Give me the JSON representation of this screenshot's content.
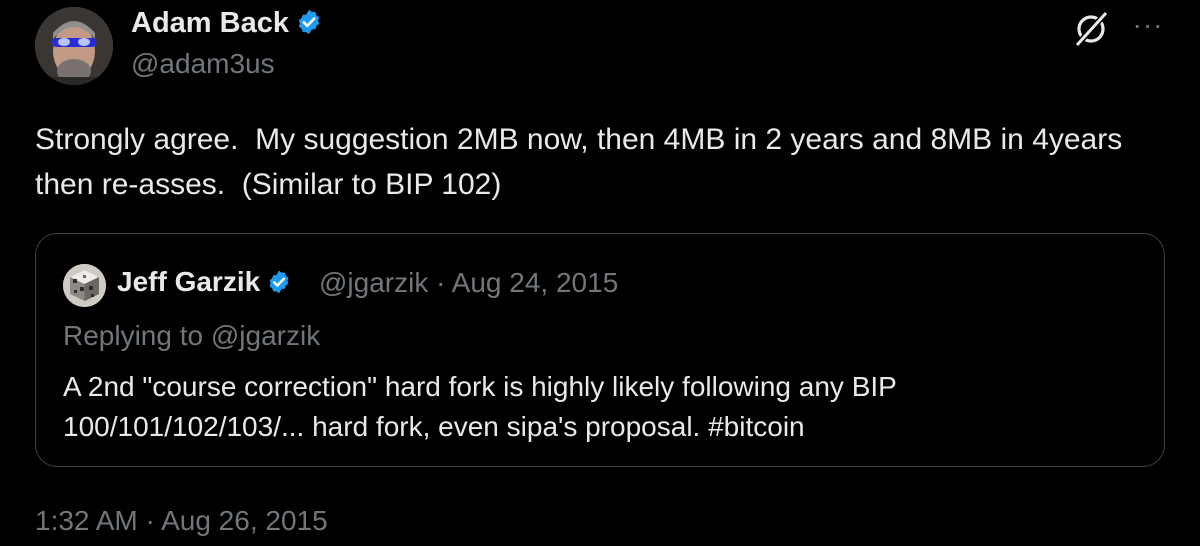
{
  "tweet": {
    "author": {
      "name": "Adam Back",
      "handle": "@adam3us",
      "verified": true
    },
    "text": "Strongly agree.  My suggestion 2MB now, then 4MB in 2 years and 8MB in 4years then re-asses.  (Similar to BIP 102)",
    "timestamp": "1:32 AM · Aug 26, 2015",
    "quoted": {
      "author_name": "Jeff Garzik",
      "meta": "@jgarzik · Aug 24, 2015",
      "replying_to": "Replying to @jgarzik",
      "text": "A 2nd \"course correction\" hard fork is highly likely following any BIP 100/101/102/103/... hard fork, even sipa's proposal. #bitcoin"
    }
  },
  "icons": {
    "grok": "grok-icon",
    "more": "more-icon",
    "verified": "verified-badge-icon"
  },
  "colors": {
    "background": "#000000",
    "text": "#e7e9ea",
    "secondary": "#71767b",
    "verified": "#1d9bf0",
    "border": "#3e4144"
  }
}
